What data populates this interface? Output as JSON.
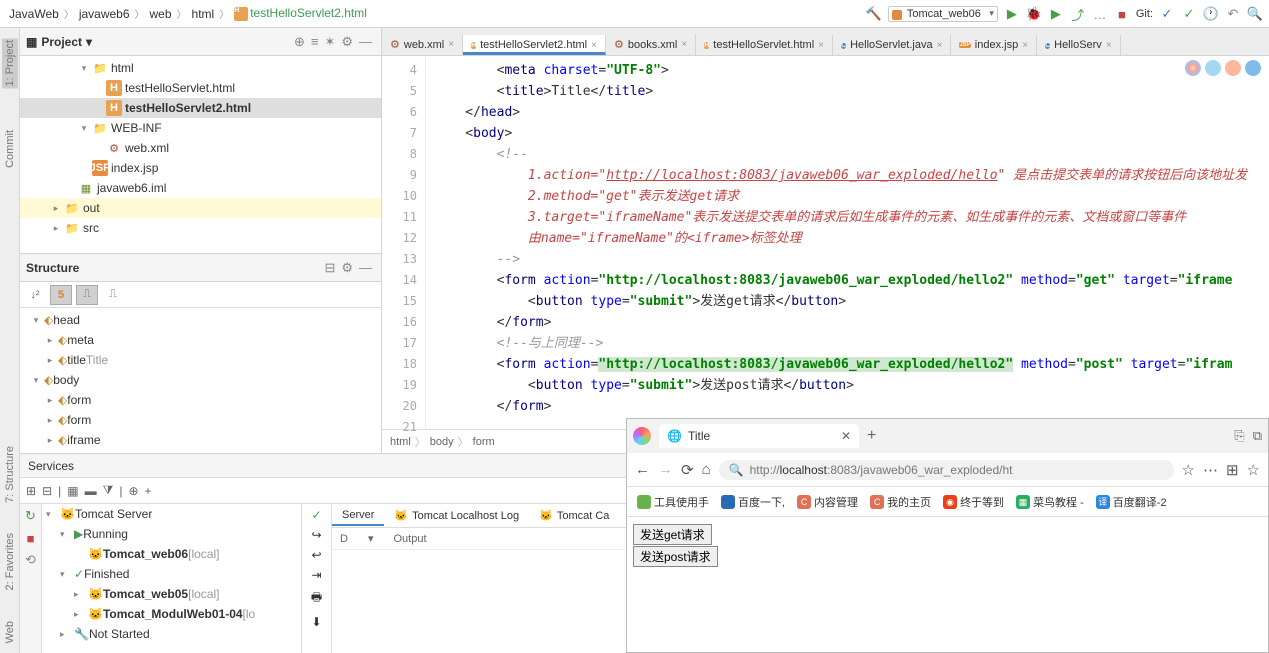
{
  "breadcrumb": {
    "items": [
      "JavaWeb",
      "javaweb6",
      "web",
      "html",
      "testHelloServlet2.html"
    ],
    "activeIndex": 4
  },
  "run_config": "Tomcat_web06",
  "git_label": "Git:",
  "left_tabs": {
    "project": "1: Project",
    "commit": "Commit"
  },
  "left_tabs2": {
    "structure": "7: Structure",
    "favorites": "2: Favorites",
    "web": "Web"
  },
  "project": {
    "title": "Project",
    "tree": [
      {
        "d": 4,
        "arrow": "▾",
        "icon": "folder",
        "label": "html"
      },
      {
        "d": 5,
        "arrow": "",
        "icon": "html",
        "label": "testHelloServlet.html"
      },
      {
        "d": 5,
        "arrow": "",
        "icon": "html",
        "label": "testHelloServlet2.html",
        "sel": true
      },
      {
        "d": 4,
        "arrow": "▾",
        "icon": "folder",
        "label": "WEB-INF"
      },
      {
        "d": 5,
        "arrow": "",
        "icon": "xml",
        "label": "web.xml"
      },
      {
        "d": 4,
        "arrow": "",
        "icon": "jsp",
        "label": "index.jsp"
      },
      {
        "d": 3,
        "arrow": "",
        "icon": "iml",
        "label": "javaweb6.iml"
      },
      {
        "d": 2,
        "arrow": "▸",
        "icon": "folder",
        "label": "out",
        "hi": true
      },
      {
        "d": 2,
        "arrow": "▸",
        "icon": "folder",
        "label": "src"
      }
    ]
  },
  "structure": {
    "title": "Structure",
    "items": [
      {
        "d": 0,
        "arrow": "▾",
        "label": "head",
        "tag": true
      },
      {
        "d": 1,
        "arrow": "▸",
        "label": "meta",
        "tag": true
      },
      {
        "d": 1,
        "arrow": "▸",
        "label": "title",
        "tag": true,
        "suffix": "Title"
      },
      {
        "d": 0,
        "arrow": "▾",
        "label": "body",
        "tag": true
      },
      {
        "d": 1,
        "arrow": "▸",
        "label": "form",
        "tag": true
      },
      {
        "d": 1,
        "arrow": "▸",
        "label": "form",
        "tag": true
      },
      {
        "d": 1,
        "arrow": "▸",
        "label": "iframe",
        "tag": true
      }
    ]
  },
  "tabs": [
    {
      "icon": "xml",
      "label": "web.xml"
    },
    {
      "icon": "html",
      "label": "testHelloServlet2.html",
      "active": true
    },
    {
      "icon": "xml",
      "label": "books.xml"
    },
    {
      "icon": "html",
      "label": "testHelloServlet.html"
    },
    {
      "icon": "java",
      "label": "HelloServlet.java"
    },
    {
      "icon": "jsp",
      "label": "index.jsp"
    },
    {
      "icon": "java",
      "label": "HelloServ"
    }
  ],
  "editor": {
    "line_start": 4,
    "lines": [
      {
        "t": "tag",
        "html": "        <<t>meta</t> <a>charset</a>=<s>\"UTF-8\"</s>>"
      },
      {
        "t": "tag",
        "html": "        <<t>title</t>>Title</<t>title</t>>"
      },
      {
        "t": "tag",
        "html": "    </<t>head</t>>"
      },
      {
        "t": "tag",
        "html": "    <<t>body</t>>"
      },
      {
        "t": "cmt",
        "html": "        <!--"
      },
      {
        "t": "red",
        "html": "            1.action=\"<u>http://localhost:8083/javaweb06_war_exploded/hello</u>\" 是点击提交表单的请求按钮后向该地址发"
      },
      {
        "t": "red",
        "html": "            2.method=\"get\"表示发送get请求"
      },
      {
        "t": "red",
        "html": "            3.target=\"iframeName\"表示发送提交表单的请求后如生成事件的元素、如生成事件的元素、文档或窗口等事件"
      },
      {
        "t": "red",
        "html": "            由name=\"iframeName\"的<iframe>标签处理"
      },
      {
        "t": "cmt",
        "html": "        -->"
      },
      {
        "t": "tag",
        "html": "        <<t>form</t> <a>action</a>=<s>\"http://localhost:8083/javaweb06_war_exploded/hello2\"</s> <a>method</a>=<s>\"get\"</s> <a>target</a>=<s>\"iframe"
      },
      {
        "t": "tag",
        "html": "            <<t>button</t> <a>type</a>=<s>\"submit\"</s>>发送get请求</<t>button</t>>"
      },
      {
        "t": "tag",
        "html": "        </<t>form</t>>"
      },
      {
        "t": "cmt",
        "html": "        <!--与上同理-->"
      },
      {
        "t": "tag",
        "html": "        <<t>form</t> <a>action</a>=<hl>\"http://localhost:8083/javaweb06_war_exploded/hello2\"</hl> <a>method</a>=<s>\"post\"</s> <a>target</a>=<s>\"ifram"
      },
      {
        "t": "tag",
        "html": "            <<t>button</t> <a>type</a>=<s>\"submit\"</s>>发送post请求</<t>button</t>>"
      },
      {
        "t": "tag",
        "html": "        </<t>form</t>>"
      },
      {
        "t": "tag",
        "html": ""
      }
    ],
    "crumbs": [
      "html",
      "body",
      "form"
    ]
  },
  "services": {
    "title": "Services",
    "tree": [
      {
        "d": 0,
        "arrow": "▾",
        "icon": "🐱",
        "label": "Tomcat Server"
      },
      {
        "d": 1,
        "arrow": "▾",
        "icon": "▶",
        "iconColor": "#4a9c4a",
        "label": "Running"
      },
      {
        "d": 2,
        "arrow": "",
        "icon": "🐱",
        "label": "Tomcat_web06",
        "bold": true,
        "suffix": "[local]"
      },
      {
        "d": 1,
        "arrow": "▾",
        "icon": "✓",
        "iconColor": "#4a9c4a",
        "label": "Finished"
      },
      {
        "d": 2,
        "arrow": "▸",
        "icon": "🐱",
        "label": "Tomcat_web05",
        "bold": true,
        "suffix": "[local]"
      },
      {
        "d": 2,
        "arrow": "▸",
        "icon": "🐱",
        "label": "Tomcat_ModulWeb01-04",
        "bold": true,
        "suffix": "[lo"
      },
      {
        "d": 1,
        "arrow": "▸",
        "icon": "🔧",
        "label": "Not Started"
      }
    ],
    "tabs": [
      "Server",
      "Tomcat Localhost Log",
      "Tomcat Ca"
    ],
    "out_columns": [
      "D",
      "Output"
    ]
  },
  "browser": {
    "tab_title": "Title",
    "url_display": "localhost",
    "url_rest": ":8083/javaweb06_war_exploded/ht",
    "url_prefix": "http://",
    "bookmarks": [
      {
        "color": "#6ab04c",
        "label": "工具使用手"
      },
      {
        "color": "#2b6cb0",
        "label": "百度一下,",
        "icon": "🐾"
      },
      {
        "color": "#e17055",
        "label": "内容管理",
        "icon": "C"
      },
      {
        "color": "#e17055",
        "label": "我的主页",
        "icon": "C"
      },
      {
        "color": "#e84118",
        "label": "终于等到",
        "icon": "◉"
      },
      {
        "color": "#27ae60",
        "label": "菜鸟教程 -",
        "icon": "▦"
      },
      {
        "color": "#2e86de",
        "label": "百度翻译-2",
        "icon": "译"
      }
    ],
    "buttons": [
      "发送get请求",
      "发送post请求"
    ]
  }
}
